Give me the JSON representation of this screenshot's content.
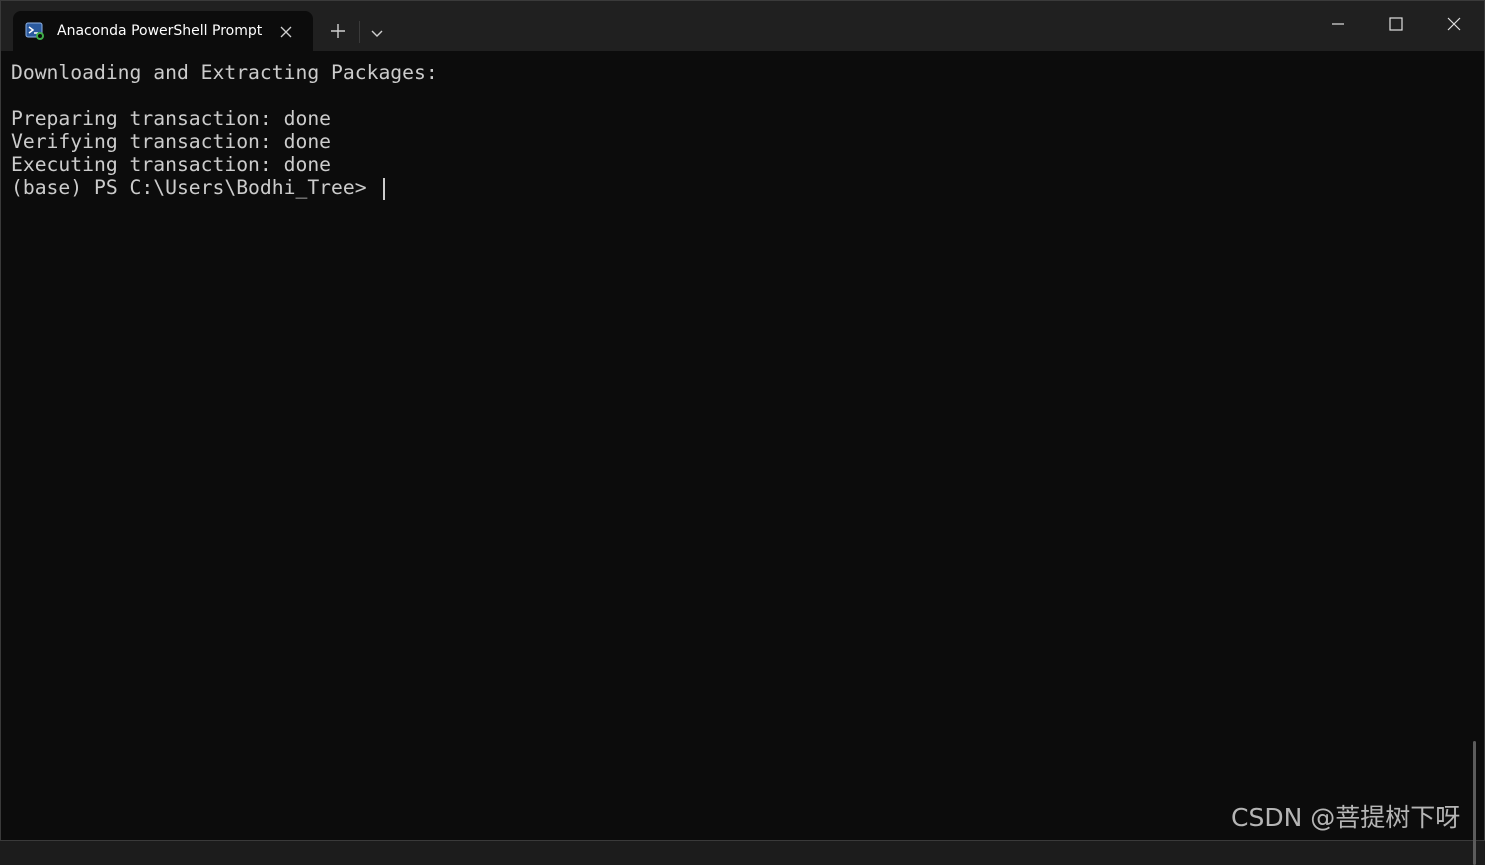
{
  "window": {
    "tab_title": "Anaconda PowerShell Prompt",
    "icons": {
      "tab_icon": "powershell-icon",
      "tab_close": "close-icon",
      "new_tab": "plus-icon",
      "dropdown": "chevron-down-icon",
      "minimize": "minimize-icon",
      "maximize": "maximize-icon",
      "close": "close-icon"
    }
  },
  "terminal": {
    "lines": [
      "Downloading and Extracting Packages:",
      "",
      "Preparing transaction: done",
      "Verifying transaction: done",
      "Executing transaction: done",
      "(base) PS C:\\Users\\Bodhi_Tree> "
    ]
  },
  "watermark": "CSDN @菩提树下呀",
  "colors": {
    "background": "#0c0c0c",
    "titlebar": "#202020",
    "text": "#cccccc"
  }
}
